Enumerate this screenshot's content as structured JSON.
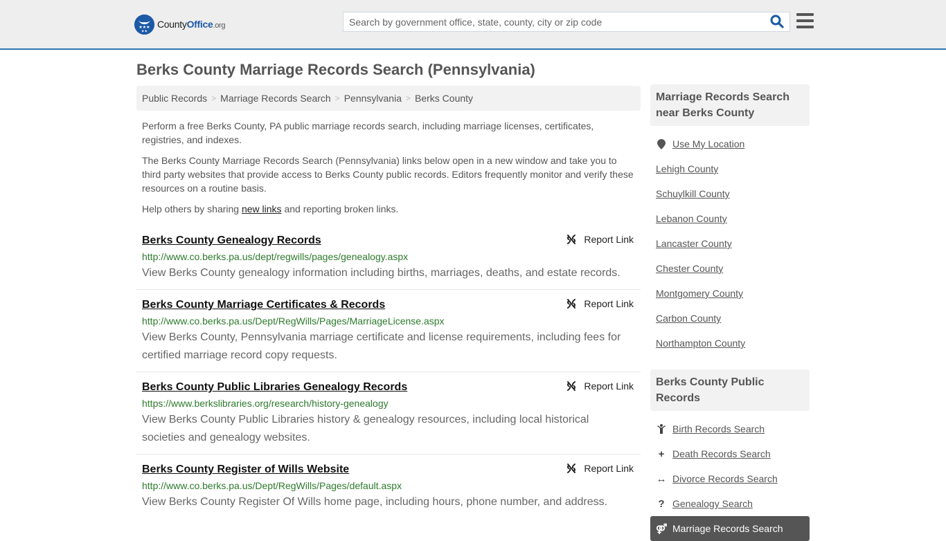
{
  "header": {
    "logo": {
      "brand_prefix": "County",
      "brand_main": "Office",
      "brand_suffix": ".org",
      "badge_icon": "eagle-stars-icon"
    },
    "search": {
      "placeholder": "Search by government office, state, county, city or zip code",
      "value": "",
      "icon": "search-icon"
    },
    "menu_icon": "hamburger-menu-icon",
    "accent_color": "#2f73b0"
  },
  "page_title": "Berks County Marriage Records Search (Pennsylvania)",
  "breadcrumb": [
    {
      "label": "Public Records"
    },
    {
      "label": "Marriage Records Search"
    },
    {
      "label": "Pennsylvania"
    },
    {
      "label": "Berks County"
    }
  ],
  "breadcrumb_separator": ">",
  "intro": {
    "p1": "Perform a free Berks County, PA public marriage records search, including marriage licenses, certificates, registries, and indexes.",
    "p2": "The Berks County Marriage Records Search (Pennsylvania) links below open in a new window and take you to third party websites that provide access to Berks County public records. Editors frequently monitor and verify these resources on a routine basis.",
    "p3_before": "Help others by sharing ",
    "p3_link": "new links",
    "p3_after": " and reporting broken links."
  },
  "records": [
    {
      "title": "Berks County Genealogy Records",
      "url": "http://www.co.berks.pa.us/dept/regwills/pages/genealogy.aspx",
      "description": "View Berks County genealogy information including births, marriages, deaths, and estate records.",
      "report_label": "Report Link"
    },
    {
      "title": "Berks County Marriage Certificates & Records",
      "url": "http://www.co.berks.pa.us/Dept/RegWills/Pages/MarriageLicense.aspx",
      "description": "View Berks County, Pennsylvania marriage certificate and license requirements, including fees for certified marriage record copy requests.",
      "report_label": "Report Link"
    },
    {
      "title": "Berks County Public Libraries Genealogy Records",
      "url": "https://www.berkslibraries.org/research/history-genealogy",
      "description": "View Berks County Public Libraries history & genealogy resources, including local historical societies and genealogy websites.",
      "report_label": "Report Link"
    },
    {
      "title": "Berks County Register of Wills Website",
      "url": "http://www.co.berks.pa.us/Dept/RegWills/Pages/default.aspx",
      "description": "View Berks County Register Of Wills home page, including hours, phone number, and address.",
      "report_label": "Report Link"
    }
  ],
  "sidebar": {
    "nearby": {
      "heading": "Marriage Records Search near Berks County",
      "use_location": "Use My Location",
      "counties": [
        "Lehigh County",
        "Schuylkill County",
        "Lebanon County",
        "Lancaster County",
        "Chester County",
        "Montgomery County",
        "Carbon County",
        "Northampton County"
      ]
    },
    "public_records": {
      "heading": "Berks County Public Records",
      "items": [
        {
          "label": "Birth Records Search",
          "icon": "child-icon",
          "glyph": "Ὣ8"
        },
        {
          "label": "Death Records Search",
          "icon": "plus-icon",
          "glyph": "+"
        },
        {
          "label": "Divorce Records Search",
          "icon": "arrows-horizontal-icon",
          "glyph": "↔"
        },
        {
          "label": "Genealogy Search",
          "icon": "question-icon",
          "glyph": "?"
        }
      ],
      "active_item": {
        "label": "Marriage Records Search",
        "icon": "marriage-symbol-icon",
        "glyph": "⚤"
      }
    }
  }
}
